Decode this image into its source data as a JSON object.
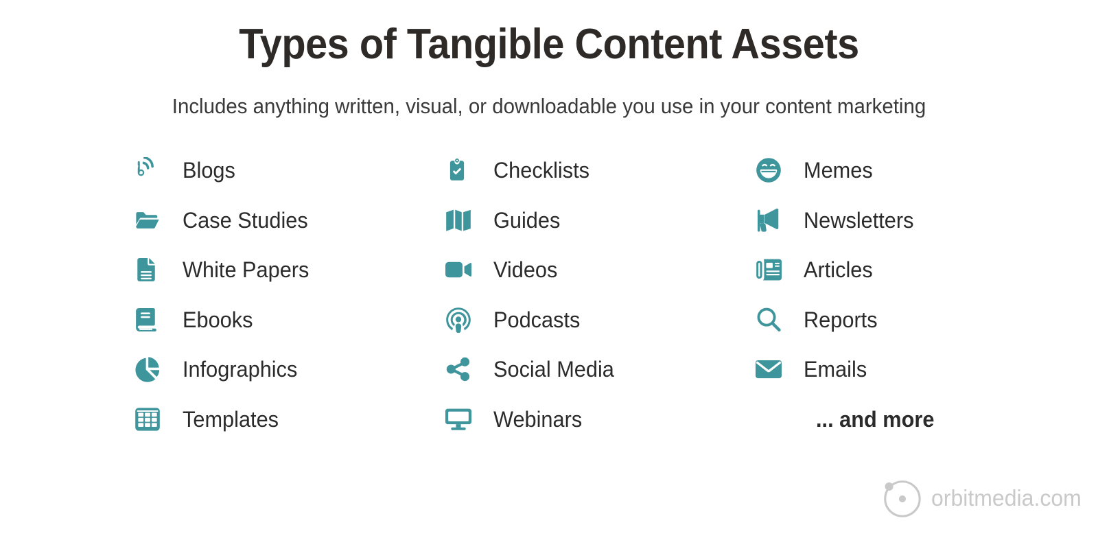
{
  "header": {
    "title": "Types of Tangible Content Assets",
    "subtitle": "Includes anything written, visual, or downloadable you use in your content marketing"
  },
  "theme": {
    "accent": "#3E959C",
    "text": "#2B2B2B",
    "title_color": "#2E2A28",
    "logo_gray": "#C9C9C9",
    "background": "#FFFFFF"
  },
  "columns": [
    {
      "items": [
        {
          "label": "Blogs",
          "icon": "blog-icon"
        },
        {
          "label": "Case Studies",
          "icon": "folder-icon"
        },
        {
          "label": "White Papers",
          "icon": "document-icon"
        },
        {
          "label": "Ebooks",
          "icon": "book-icon"
        },
        {
          "label": "Infographics",
          "icon": "pie-chart-icon"
        },
        {
          "label": "Templates",
          "icon": "grid-table-icon"
        }
      ]
    },
    {
      "items": [
        {
          "label": "Checklists",
          "icon": "clipboard-check-icon"
        },
        {
          "label": "Guides",
          "icon": "map-icon"
        },
        {
          "label": "Videos",
          "icon": "video-camera-icon"
        },
        {
          "label": "Podcasts",
          "icon": "podcast-icon"
        },
        {
          "label": "Social Media",
          "icon": "share-nodes-icon"
        },
        {
          "label": "Webinars",
          "icon": "desktop-monitor-icon"
        }
      ]
    },
    {
      "items": [
        {
          "label": "Memes",
          "icon": "grin-face-icon"
        },
        {
          "label": "Newsletters",
          "icon": "bullhorn-icon"
        },
        {
          "label": "Articles",
          "icon": "newspaper-icon"
        },
        {
          "label": "Reports",
          "icon": "magnifying-glass-icon"
        },
        {
          "label": "Emails",
          "icon": "envelope-icon"
        },
        {
          "label": "... and more",
          "icon": ""
        }
      ]
    }
  ],
  "logo": {
    "text": "orbitmedia.com",
    "mark": "orbit-logo-icon"
  }
}
